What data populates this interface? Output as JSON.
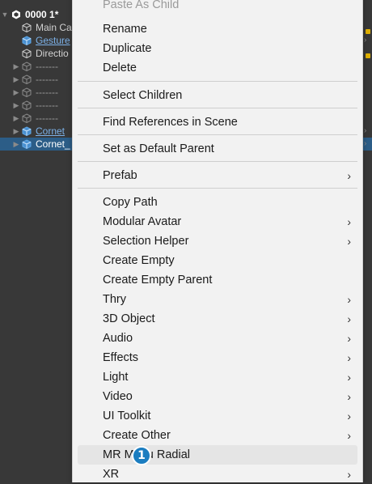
{
  "hierarchy": {
    "root": "0000 1*",
    "items": [
      {
        "label": "Main Ca",
        "style": "normal"
      },
      {
        "label": "Gesture",
        "style": "blue"
      },
      {
        "label": "Directio",
        "style": "normal"
      },
      {
        "label": "-------",
        "style": "dim"
      },
      {
        "label": "-------",
        "style": "dim"
      },
      {
        "label": "-------",
        "style": "dim"
      },
      {
        "label": "-------",
        "style": "dim"
      },
      {
        "label": "-------",
        "style": "dim"
      },
      {
        "label": "Cornet",
        "style": "blue"
      },
      {
        "label": "Cornet_",
        "style": "selected"
      }
    ]
  },
  "menu": {
    "items": [
      {
        "label": "Paste As Child",
        "disabled": true
      },
      {
        "label": "Rename"
      },
      {
        "label": "Duplicate"
      },
      {
        "label": "Delete"
      },
      {
        "label": "Select Children"
      },
      {
        "label": "Find References in Scene"
      },
      {
        "label": "Set as Default Parent"
      },
      {
        "label": "Prefab",
        "submenu": true
      },
      {
        "label": "Copy Path"
      },
      {
        "label": "Modular Avatar",
        "submenu": true
      },
      {
        "label": "Selection Helper",
        "submenu": true
      },
      {
        "label": "Create Empty"
      },
      {
        "label": "Create Empty Parent"
      },
      {
        "label": "Thry",
        "submenu": true
      },
      {
        "label": "3D Object",
        "submenu": true
      },
      {
        "label": "Audio",
        "submenu": true
      },
      {
        "label": "Effects",
        "submenu": true
      },
      {
        "label": "Light",
        "submenu": true
      },
      {
        "label": "Video",
        "submenu": true
      },
      {
        "label": "UI Toolkit",
        "submenu": true
      },
      {
        "label": "Create Other",
        "submenu": true
      },
      {
        "label": "MR Menu Radial",
        "hovered": true
      },
      {
        "label": "XR",
        "submenu": true
      }
    ],
    "submenu_arrow": "›"
  },
  "badge": {
    "number": "1"
  },
  "icons": {
    "unity_logo": "unity-logo-icon",
    "cube": "gameobject-cube-icon",
    "fold": "foldout-triangle-icon",
    "submenu": "chevron-right-icon"
  },
  "colors": {
    "selection": "#2c5d87",
    "badge": "#1b7dc0",
    "menu_bg": "#f2f2f2"
  }
}
